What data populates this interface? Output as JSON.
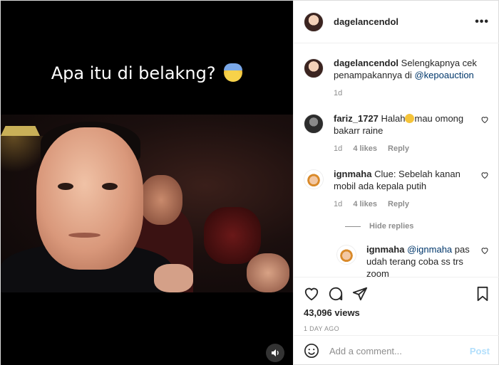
{
  "video": {
    "caption_text": "Apa itu di belakng?",
    "caption_emoji": "fearful-face-emoji",
    "volume_icon": "speaker-icon"
  },
  "post": {
    "username": "dagelancendol",
    "more_label": "•••"
  },
  "caption_comment": {
    "username": "dagelancendol",
    "text": "Selengkapnya cek penampakannya di",
    "mention": "@kepoauction",
    "time": "1d"
  },
  "comments": [
    {
      "username": "fariz_1727",
      "text_a": "Halah",
      "text_b": "mau omong bakarr raine",
      "time": "1d",
      "likes": "4 likes",
      "reply": "Reply"
    },
    {
      "username": "ignmaha",
      "text": "Clue: Sebelah kanan mobil ada kepala putih",
      "time": "1d",
      "likes": "4 likes",
      "reply": "Reply"
    }
  ],
  "hide_replies": "Hide replies",
  "reply_comment": {
    "username": "ignmaha",
    "mention": "@ignmaha",
    "text": "pas udah terang coba ss trs zoom"
  },
  "stats": {
    "views": "43,096 views",
    "date": "1 DAY AGO"
  },
  "add_comment": {
    "placeholder": "Add a comment...",
    "post_label": "Post"
  },
  "colors": {
    "link": "#00376b",
    "muted": "#8e8e8e",
    "post_disabled": "#b2dffc"
  }
}
